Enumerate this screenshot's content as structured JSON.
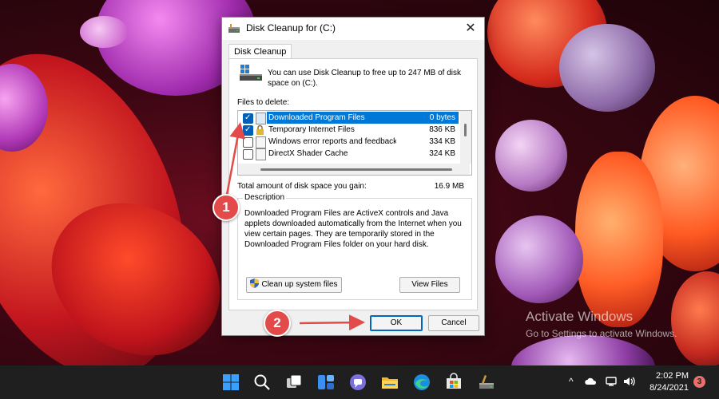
{
  "dialog": {
    "title": "Disk Cleanup for  (C:)",
    "close_symbol": "✕",
    "tab_label": "Disk Cleanup",
    "intro_text": "You can use Disk Cleanup to free up to 247 MB of disk space on  (C:).",
    "files_to_delete_label": "Files to delete:",
    "files": [
      {
        "name": "Downloaded Program Files",
        "size": "0 bytes",
        "checked": true,
        "selected": true,
        "icon": "folder-icon"
      },
      {
        "name": "Temporary Internet Files",
        "size": "836 KB",
        "checked": true,
        "selected": false,
        "icon": "lock-icon"
      },
      {
        "name": "Windows error reports and feedback di...",
        "size": "334 KB",
        "checked": false,
        "selected": false,
        "icon": "file-icon"
      },
      {
        "name": "DirectX Shader Cache",
        "size": "324 KB",
        "checked": false,
        "selected": false,
        "icon": "file-icon"
      }
    ],
    "gain_label": "Total amount of disk space you gain:",
    "gain_value": "16.9 MB",
    "description_label": "Description",
    "description_text": "Downloaded Program Files are ActiveX controls and Java applets downloaded automatically from the Internet when you view certain pages. They are temporarily stored in the Downloaded Program Files folder on your hard disk.",
    "cleanup_system_files_label": "Clean up system files",
    "view_files_label": "View Files",
    "ok_label": "OK",
    "cancel_label": "Cancel"
  },
  "annotations": {
    "step1": "1",
    "step2": "2",
    "arrow_color": "#e34a4a"
  },
  "watermark": {
    "line1": "Activate Windows",
    "line2": "Go to Settings to activate Windows."
  },
  "taskbar": {
    "icons": [
      "windows-start-icon",
      "search-icon",
      "task-view-icon",
      "widgets-icon",
      "teams-chat-icon",
      "file-explorer-icon",
      "edge-icon",
      "store-icon",
      "disk-cleanup-icon"
    ],
    "clock_time": "2:02 PM",
    "clock_date": "8/24/2021",
    "notification_count": "3",
    "tray_chevron": "^"
  }
}
